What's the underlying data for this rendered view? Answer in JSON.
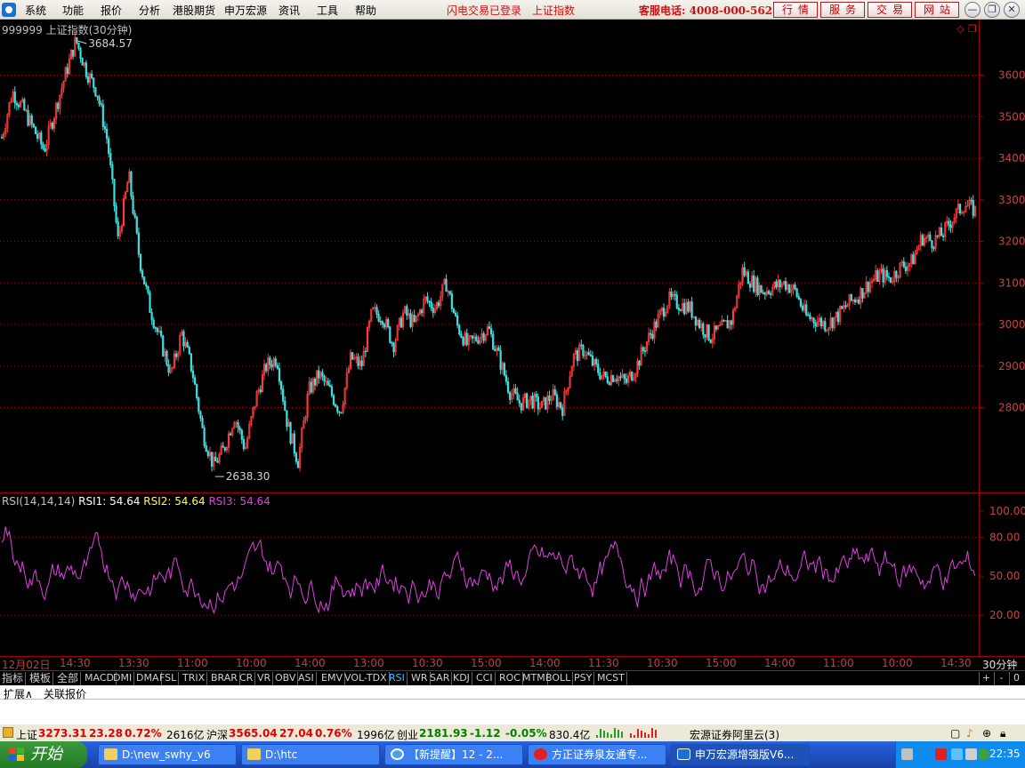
{
  "menu": {
    "items": [
      "系统",
      "功能",
      "报价",
      "分析",
      "港股期货",
      "申万宏源",
      "资讯",
      "工具",
      "帮助"
    ],
    "status_login": "闪电交易已登录",
    "current_index": "上证指数",
    "hotline": "客服电话: 4008-000-562",
    "quick_buttons": [
      "行情",
      "服务",
      "交易",
      "网站"
    ]
  },
  "chart": {
    "title": "999999 上证指数(30分钟)",
    "high_label": "3684.57",
    "low_label": "2638.30",
    "price_ticks": [
      "3600",
      "3500",
      "3400",
      "3300",
      "3200",
      "3100",
      "3000",
      "2900",
      "2800"
    ],
    "rsi_ticks": [
      "100.00",
      "80.00",
      "50.00",
      "20.00"
    ],
    "rsi_label": "RSI(14,14,14)",
    "rsi1": "RSI1: 54.64",
    "rsi2": "RSI2: 54.64",
    "rsi3": "RSI3: 54.64"
  },
  "chart_data": {
    "type": "candlestick",
    "title": "999999 上证指数(30分钟)",
    "ylim": [
      2600,
      3720
    ],
    "y_ticks": [
      2800,
      2900,
      3000,
      3100,
      3200,
      3300,
      3400,
      3500,
      3600
    ],
    "annotations": [
      {
        "label": "3684.57",
        "value": 3684.57
      },
      {
        "label": "2638.30",
        "value": 2638.3
      }
    ],
    "trend_points": [
      [
        0,
        3450
      ],
      [
        1,
        3560
      ],
      [
        2,
        3520
      ],
      [
        3,
        3470
      ],
      [
        4,
        3420
      ],
      [
        5,
        3510
      ],
      [
        6,
        3600
      ],
      [
        7,
        3684.57
      ],
      [
        8,
        3610
      ],
      [
        9,
        3560
      ],
      [
        10,
        3440
      ],
      [
        11,
        3200
      ],
      [
        12,
        3360
      ],
      [
        13,
        3160
      ],
      [
        14,
        3040
      ],
      [
        15,
        2960
      ],
      [
        16,
        2880
      ],
      [
        17,
        2980
      ],
      [
        18,
        2890
      ],
      [
        19,
        2740
      ],
      [
        20,
        2660
      ],
      [
        21,
        2700
      ],
      [
        22,
        2780
      ],
      [
        23,
        2700
      ],
      [
        24,
        2820
      ],
      [
        25,
        2900
      ],
      [
        26,
        2920
      ],
      [
        27,
        2760
      ],
      [
        28,
        2670
      ],
      [
        29,
        2840
      ],
      [
        30,
        2880
      ],
      [
        31,
        2840
      ],
      [
        32,
        2790
      ],
      [
        33,
        2920
      ],
      [
        34,
        2900
      ],
      [
        35,
        3030
      ],
      [
        36,
        3020
      ],
      [
        37,
        2950
      ],
      [
        38,
        3030
      ],
      [
        39,
        3000
      ],
      [
        40,
        3060
      ],
      [
        41,
        3040
      ],
      [
        42,
        3100
      ],
      [
        43,
        3000
      ],
      [
        44,
        2950
      ],
      [
        45,
        2970
      ],
      [
        46,
        2990
      ],
      [
        47,
        2920
      ],
      [
        48,
        2840
      ],
      [
        49,
        2810
      ],
      [
        50,
        2820
      ],
      [
        51,
        2800
      ],
      [
        52,
        2830
      ],
      [
        53,
        2800
      ],
      [
        54,
        2920
      ],
      [
        55,
        2940
      ],
      [
        56,
        2900
      ],
      [
        57,
        2870
      ],
      [
        58,
        2880
      ],
      [
        59,
        2860
      ],
      [
        60,
        2900
      ],
      [
        61,
        2960
      ],
      [
        62,
        3010
      ],
      [
        63,
        3060
      ],
      [
        64,
        3050
      ],
      [
        65,
        3040
      ],
      [
        66,
        3000
      ],
      [
        67,
        2970
      ],
      [
        68,
        2990
      ],
      [
        69,
        3010
      ],
      [
        70,
        3130
      ],
      [
        71,
        3100
      ],
      [
        72,
        3080
      ],
      [
        73,
        3090
      ],
      [
        74,
        3100
      ],
      [
        75,
        3080
      ],
      [
        76,
        3020
      ],
      [
        77,
        3010
      ],
      [
        78,
        3000
      ],
      [
        79,
        3020
      ],
      [
        80,
        3050
      ],
      [
        81,
        3070
      ],
      [
        82,
        3100
      ],
      [
        83,
        3120
      ],
      [
        84,
        3110
      ],
      [
        85,
        3140
      ],
      [
        86,
        3150
      ],
      [
        87,
        3210
      ],
      [
        88,
        3200
      ],
      [
        89,
        3220
      ],
      [
        90,
        3260
      ],
      [
        91,
        3290
      ],
      [
        92,
        3273.31
      ]
    ],
    "x_labels": [
      "12月02日",
      "14:30",
      "13:30",
      "11:00",
      "10:00",
      "14:00",
      "13:00",
      "10:30",
      "15:00",
      "14:00",
      "11:30",
      "10:30",
      "15:00",
      "14:00",
      "11:00",
      "10:00",
      "14:30"
    ],
    "rsi": {
      "ylim": [
        0,
        100
      ],
      "ticks": [
        20,
        50,
        80,
        100
      ],
      "series": [
        {
          "name": "RSI3",
          "color": "#e040e0",
          "last": 54.64
        }
      ],
      "band": [
        20,
        80
      ]
    }
  },
  "time_axis": {
    "labels": [
      "12月02日",
      "14:30",
      "13:30",
      "11:00",
      "10:00",
      "14:00",
      "13:00",
      "10:30",
      "15:00",
      "14:00",
      "11:30",
      "10:30",
      "15:00",
      "14:00",
      "11:00",
      "10:00",
      "14:30"
    ],
    "period": "30分钟"
  },
  "indicator_tabs": [
    "指标",
    "模板",
    "全部",
    "MACD",
    "DMI",
    "DMA",
    "FSL",
    "TRIX",
    "BRAR",
    "CR",
    "VR",
    "OBV",
    "ASI",
    "EMV",
    "VOL-TDX",
    "RSI",
    "WR",
    "SAR",
    "KDJ",
    "CCI",
    "ROC",
    "MTM",
    "BOLL",
    "PSY",
    "MCST"
  ],
  "side_buttons": [
    "+",
    "-",
    "0"
  ],
  "ext_tabs": [
    "扩展∧",
    "关联报价"
  ],
  "status_bar": {
    "sh_label": "上证",
    "sh_value": "3273.31",
    "sh_change": "23.28",
    "sh_pct": "0.72%",
    "sh_amount": "2616亿",
    "hs_label": "沪深",
    "hs_value": "3565.04",
    "hs_change": "27.04",
    "hs_pct": "0.76%",
    "hs_amount": "1996亿",
    "cy_label": "创业",
    "cy_value": "2181.93",
    "cy_change": "-1.12",
    "cy_pct": "-0.05%",
    "cy_amount": "830.4亿",
    "broker": "宏源证券阿里云(3)"
  },
  "taskbar": {
    "start": "开始",
    "tasks": [
      "D:\\new_swhy_v6",
      "D:\\htc",
      "【新提醒】12 - 2...",
      "方正证券泉友通专...",
      "申万宏源增强版V6..."
    ],
    "clock": "22:35"
  },
  "colors": {
    "up": "#ff3c3c",
    "down": "#40e0e0",
    "grid": "#a00000",
    "rsi": "#e040e0"
  }
}
